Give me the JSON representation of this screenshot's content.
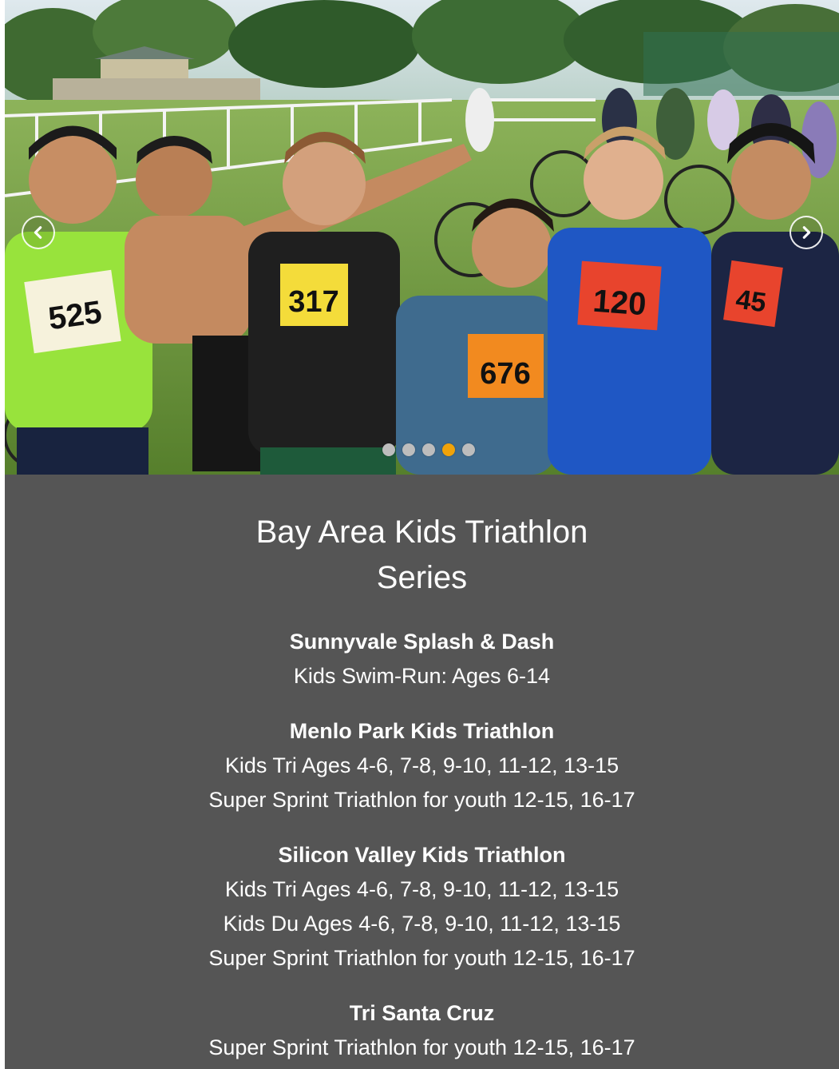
{
  "carousel": {
    "prev_label": "Previous",
    "next_label": "Next",
    "slide_count": 5,
    "active_slide": 4,
    "bib_numbers": [
      "525",
      "317",
      "676",
      "120",
      "45"
    ],
    "colors": {
      "active_dot": "#f0a30a",
      "dot": "#bdbdbd"
    }
  },
  "content": {
    "title_line1": "Bay Area Kids Triathlon",
    "title_line2": "Series",
    "events": [
      {
        "name": "Sunnyvale Splash & Dash",
        "lines": [
          "Kids Swim-Run: Ages 6-14"
        ]
      },
      {
        "name": "Menlo Park Kids Triathlon",
        "lines": [
          "Kids Tri Ages 4-6, 7-8,  9-10, 11-12, 13-15",
          "Super Sprint Triathlon for youth 12-15, 16-17"
        ]
      },
      {
        "name": "Silicon Valley Kids Triathlon",
        "lines": [
          "Kids Tri Ages 4-6, 7-8,  9-10, 11-12, 13-15",
          "Kids Du Ages 4-6, 7-8,  9-10, 11-12, 13-15",
          "Super Sprint Triathlon for youth 12-15, 16-17"
        ]
      },
      {
        "name": "Tri Santa Cruz",
        "lines": [
          "Super Sprint Triathlon for youth 12-15, 16-17"
        ]
      }
    ],
    "colors": {
      "background": "#555555",
      "text": "#ffffff"
    }
  }
}
